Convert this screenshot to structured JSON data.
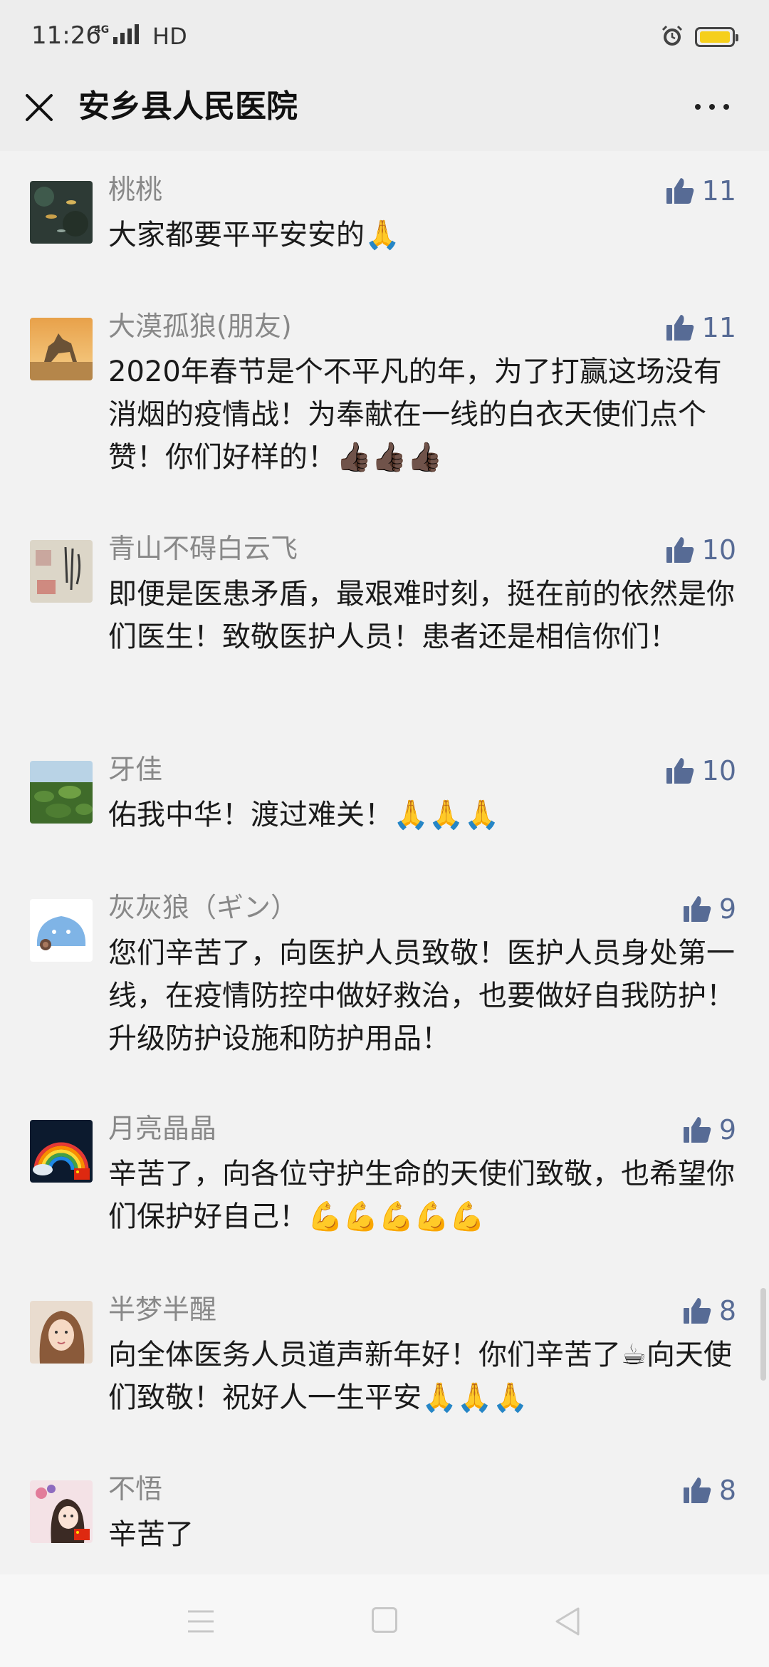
{
  "status_bar": {
    "time": "11:26",
    "network": "4G",
    "quality": "HD"
  },
  "nav": {
    "title": "安乡县人民医院"
  },
  "comments": [
    {
      "nickname": "桃桃",
      "text": "大家都要平平安安的🙏",
      "likes": "11",
      "avatar": "koi-pond-avatar"
    },
    {
      "nickname": "大漠孤狼(朋友)",
      "text": "2020年春节是个不平凡的年，为了打赢这场没有消烟的疫情战！为奉献在一线的白衣天使们点个赞！你们好样的！👍🏿👍🏿👍🏿",
      "likes": "11",
      "avatar": "wolf-avatar"
    },
    {
      "nickname": "青山不碍白云飞",
      "text": "即便是医患矛盾，最艰难时刻，挺在前的依然是你们医生！致敬医护人员！患者还是相信你们！",
      "likes": "10",
      "avatar": "calligraphy-avatar"
    },
    {
      "nickname": "牙佳",
      "text": "佑我中华！渡过难关！🙏🙏🙏",
      "likes": "10",
      "avatar": "field-avatar"
    },
    {
      "nickname": "灰灰狼（ギン）",
      "text": "您们辛苦了，向医护人员致敬！医护人员身处第一线，在疫情防控中做好救治，也要做好自我防护！升级防护设施和防护用品！",
      "likes": "9",
      "avatar": "cartoon-avatar"
    },
    {
      "nickname": "月亮晶晶",
      "text": "辛苦了，向各位守护生命的天使们致敬，也希望你们保护好自己！💪💪💪💪💪",
      "likes": "9",
      "avatar": "rainbow-avatar"
    },
    {
      "nickname": "半梦半醒",
      "text": "向全体医务人员道声新年好！你们辛苦了☕向天使们致敬！祝好人一生平安🙏🙏🙏",
      "likes": "8",
      "avatar": "girl-avatar"
    },
    {
      "nickname": "不悟",
      "text": "辛苦了",
      "likes": "8",
      "avatar": "anime-avatar"
    }
  ],
  "colors": {
    "like": "#576b95",
    "nickname": "#888888",
    "background": "#f2f2f2"
  }
}
